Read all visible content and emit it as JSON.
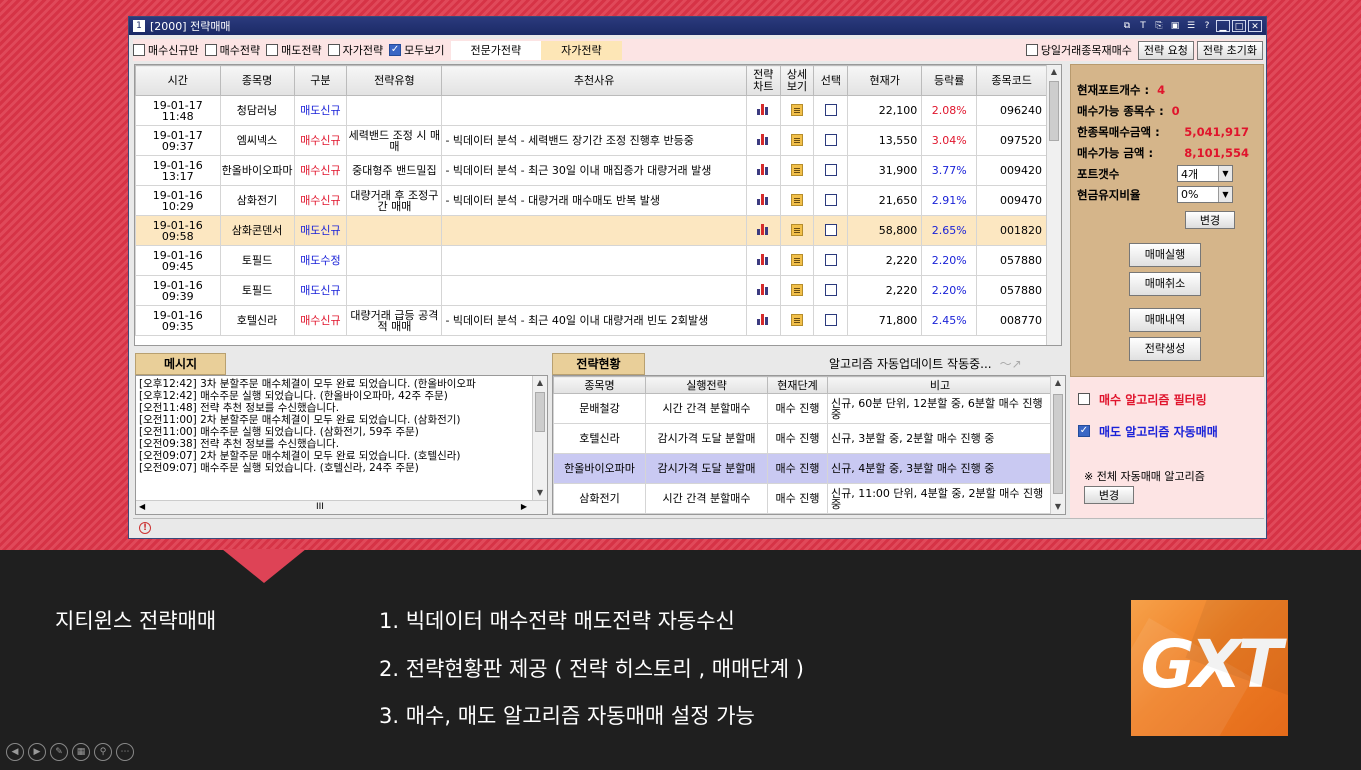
{
  "window": {
    "title": "[2000] 전략매매",
    "title_icon": "1",
    "controls": [
      "T"
    ]
  },
  "toolbar": {
    "checks": [
      {
        "label": "매수신규만",
        "checked": false
      },
      {
        "label": "매수전략",
        "checked": false
      },
      {
        "label": "매도전략",
        "checked": false
      },
      {
        "label": "자가전략",
        "checked": false
      },
      {
        "label": "모두보기",
        "checked": true
      }
    ],
    "tag_expert": "전문가전략",
    "tag_self": "자가전략",
    "today_check": "당일거래종목재매수",
    "btn_request": "전략 요청",
    "btn_reset": "전략 초기화"
  },
  "grid": {
    "headers": [
      "시간",
      "종목명",
      "구분",
      "전략유형",
      "추천사유",
      "전략\n차트",
      "상세\n보기",
      "선택",
      "현재가",
      "등락률",
      "종목코드"
    ],
    "rows": [
      {
        "date": "19-01-17",
        "time": "11:48",
        "name": "청담러닝",
        "type": "매도신규",
        "type_color": "blue",
        "strategy": "",
        "reason": "",
        "price": "22,100",
        "rate": "2.08%",
        "rate_color": "red",
        "code": "096240"
      },
      {
        "date": "19-01-17",
        "time": "09:37",
        "name": "엠씨넥스",
        "type": "매수신규",
        "type_color": "red",
        "strategy": "세력밴드 조정 시 매매",
        "reason": "- 빅데이터 분석 - 세력밴드 장기간 조정 진행후 반등중",
        "price": "13,550",
        "rate": "3.04%",
        "rate_color": "red",
        "code": "097520"
      },
      {
        "date": "19-01-16",
        "time": "13:17",
        "name": "한올바이오파마",
        "type": "매수신규",
        "type_color": "red",
        "strategy": "중대형주 밴드밀집",
        "reason": "- 빅데이터 분석 - 최근 30일 이내 매집증가 대량거래 발생",
        "price": "31,900",
        "rate": "3.77%",
        "rate_color": "blue",
        "code": "009420"
      },
      {
        "date": "19-01-16",
        "time": "10:29",
        "name": "삼화전기",
        "type": "매수신규",
        "type_color": "red",
        "strategy": "대량거래 후 조정구간 매매",
        "reason": "- 빅데이터 분석 - 대량거래 매수매도 반복 발생",
        "price": "21,650",
        "rate": "2.91%",
        "rate_color": "blue",
        "code": "009470"
      },
      {
        "date": "19-01-16",
        "time": "09:58",
        "name": "삼화콘덴서",
        "type": "매도신규",
        "type_color": "blue",
        "strategy": "",
        "reason": "",
        "price": "58,800",
        "rate": "2.65%",
        "rate_color": "blue",
        "code": "001820",
        "selected": true
      },
      {
        "date": "19-01-16",
        "time": "09:45",
        "name": "토필드",
        "type": "매도수정",
        "type_color": "blue",
        "strategy": "",
        "reason": "",
        "price": "2,220",
        "rate": "2.20%",
        "rate_color": "blue",
        "code": "057880"
      },
      {
        "date": "19-01-16",
        "time": "09:39",
        "name": "토필드",
        "type": "매도신규",
        "type_color": "blue",
        "strategy": "",
        "reason": "",
        "price": "2,220",
        "rate": "2.20%",
        "rate_color": "blue",
        "code": "057880"
      },
      {
        "date": "19-01-16",
        "time": "09:35",
        "name": "호텔신라",
        "type": "매수신규",
        "type_color": "red",
        "strategy": "대량거래 급등 공격적 매매",
        "reason": "- 빅데이터 분석 - 최근 40일 이내 대량거래 빈도 2회발생",
        "price": "71,800",
        "rate": "2.45%",
        "rate_color": "blue",
        "code": "008770"
      }
    ]
  },
  "messages": {
    "tab": "메시지",
    "lines": [
      "[오후12:42] 3차 분할주문 매수체결이 모두 완료 되었습니다. (한올바이오파",
      "[오후12:42] 매수주문 실행 되었습니다. (한올바이오파마, 42주 주문)",
      "[오전11:48] 전략 추천 정보를 수신했습니다.",
      "[오전11:00] 2차 분할주문 매수체결이 모두 완료 되었습니다. (삼화전기)",
      "[오전11:00] 매수주문 실행 되었습니다. (삼화전기, 59주 주문)",
      "[오전09:38] 전략 추천 정보를 수신했습니다.",
      "[오전09:07] 2차 분할주문 매수체결이 모두 완료 되었습니다. (호텔신라)",
      "[오전09:07] 매수주문 실행 되었습니다. (호텔신라, 24주 주문)"
    ],
    "scroll_label": "III"
  },
  "status": {
    "tab": "전략현황",
    "algo_update": "알고리즘 자동업데이트 작동중...",
    "headers": [
      "종목명",
      "실행전략",
      "현재단계",
      "비고"
    ],
    "rows": [
      {
        "name": "문배철강",
        "strategy": "시간 간격 분할매수",
        "stage": "매수 진행",
        "note": "신규, 60분 단위, 12분할 중, 6분할 매수 진행 중"
      },
      {
        "name": "호텔신라",
        "strategy": "감시가격 도달 분할매",
        "stage": "매수 진행",
        "note": "신규, 3분할 중, 2분할 매수 진행 중"
      },
      {
        "name": "한올바이오파마",
        "strategy": "감시가격 도달 분할매",
        "stage": "매수 진행",
        "note": "신규, 4분할 중, 3분할 매수 진행 중",
        "selected": true
      },
      {
        "name": "삼화전기",
        "strategy": "시간 간격 분할매수",
        "stage": "매수 진행",
        "note": "신규, 11:00 단위, 4분할 중, 2분할 매수 진행 중"
      }
    ]
  },
  "side": {
    "portfolio_count_label": "현재포트개수 :",
    "portfolio_count": "4",
    "buyable_count_label": "매수가능 종목수 :",
    "buyable_count": "0",
    "per_stock_label": "한종목매수금액 :",
    "per_stock": "5,041,917",
    "buyable_amount_label": "매수가능 금액 :",
    "buyable_amount": "8,101,554",
    "port_count_label": "포트갯수",
    "port_count_value": "4개",
    "cash_ratio_label": "현금유지비율",
    "cash_ratio_value": "0%",
    "change_btn": "변경",
    "btn_exec": "매매실행",
    "btn_cancel": "매매취소",
    "btn_history": "매매내역",
    "btn_create": "전략생성",
    "buy_filter": "매수 알고리즘 필터링",
    "buy_filter_checked": false,
    "sell_auto": "매도 알고리즘 자동매매",
    "sell_auto_checked": true,
    "note": "※ 전체 자동매매 알고리즘",
    "note_btn": "변경"
  },
  "caption": {
    "title": "지티윈스 전략매매",
    "line1": "1. 빅데이터 매수전략 매도전략 자동수신",
    "line2": "2. 전략현황판 제공 ( 전략 히스토리 , 매매단계 )",
    "line3": "3. 매수, 매도 알고리즘 자동매매 설정 가능"
  },
  "colors": {
    "accent_red": "#e0142c",
    "accent_blue": "#1a22d8",
    "titlebar": "#1b2a66"
  }
}
